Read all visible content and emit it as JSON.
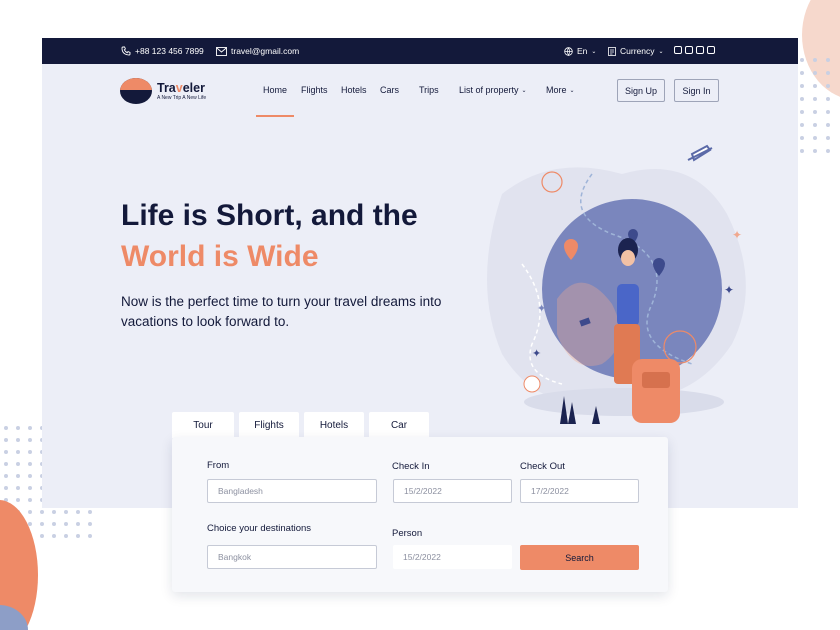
{
  "topbar": {
    "phone": "+88 123 456 7899",
    "email": "travel@gmail.com",
    "language": "En",
    "currency": "Currency",
    "social_icons": [
      "facebook-icon",
      "twitter-icon",
      "pinterest-icon",
      "instagram-icon"
    ]
  },
  "brand": {
    "name_part1": "Tra",
    "name_part2": "v",
    "name_part3": "eler",
    "tagline": "A New Trip A New Life"
  },
  "nav": {
    "items": [
      "Home",
      "Flights",
      "Hotels",
      "Cars",
      "Trips",
      "List of property",
      "More"
    ],
    "active": "Home",
    "signup": "Sign Up",
    "signin": "Sign In"
  },
  "hero": {
    "title_line1": "Life is Short, and the",
    "title_line2": "World is Wide",
    "subtitle": "Now is the perfect time to turn your travel dreams into vacations to look forward to."
  },
  "search": {
    "tabs": [
      "Tour",
      "Flights",
      "Hotels",
      "Car"
    ],
    "active_tab": "Tour",
    "from_label": "From",
    "from_value": "Bangladesh",
    "checkin_label": "Check In",
    "checkin_value": "15/2/2022",
    "checkout_label": "Check Out",
    "checkout_value": "17/2/2022",
    "destination_label": "Choice your destinations",
    "destination_value": "Bangkok",
    "person_label": "Person",
    "person_value": "15/2/2022",
    "button": "Search"
  },
  "colors": {
    "navy": "#13193a",
    "accent": "#ee8a67",
    "background": "#eceef7"
  }
}
